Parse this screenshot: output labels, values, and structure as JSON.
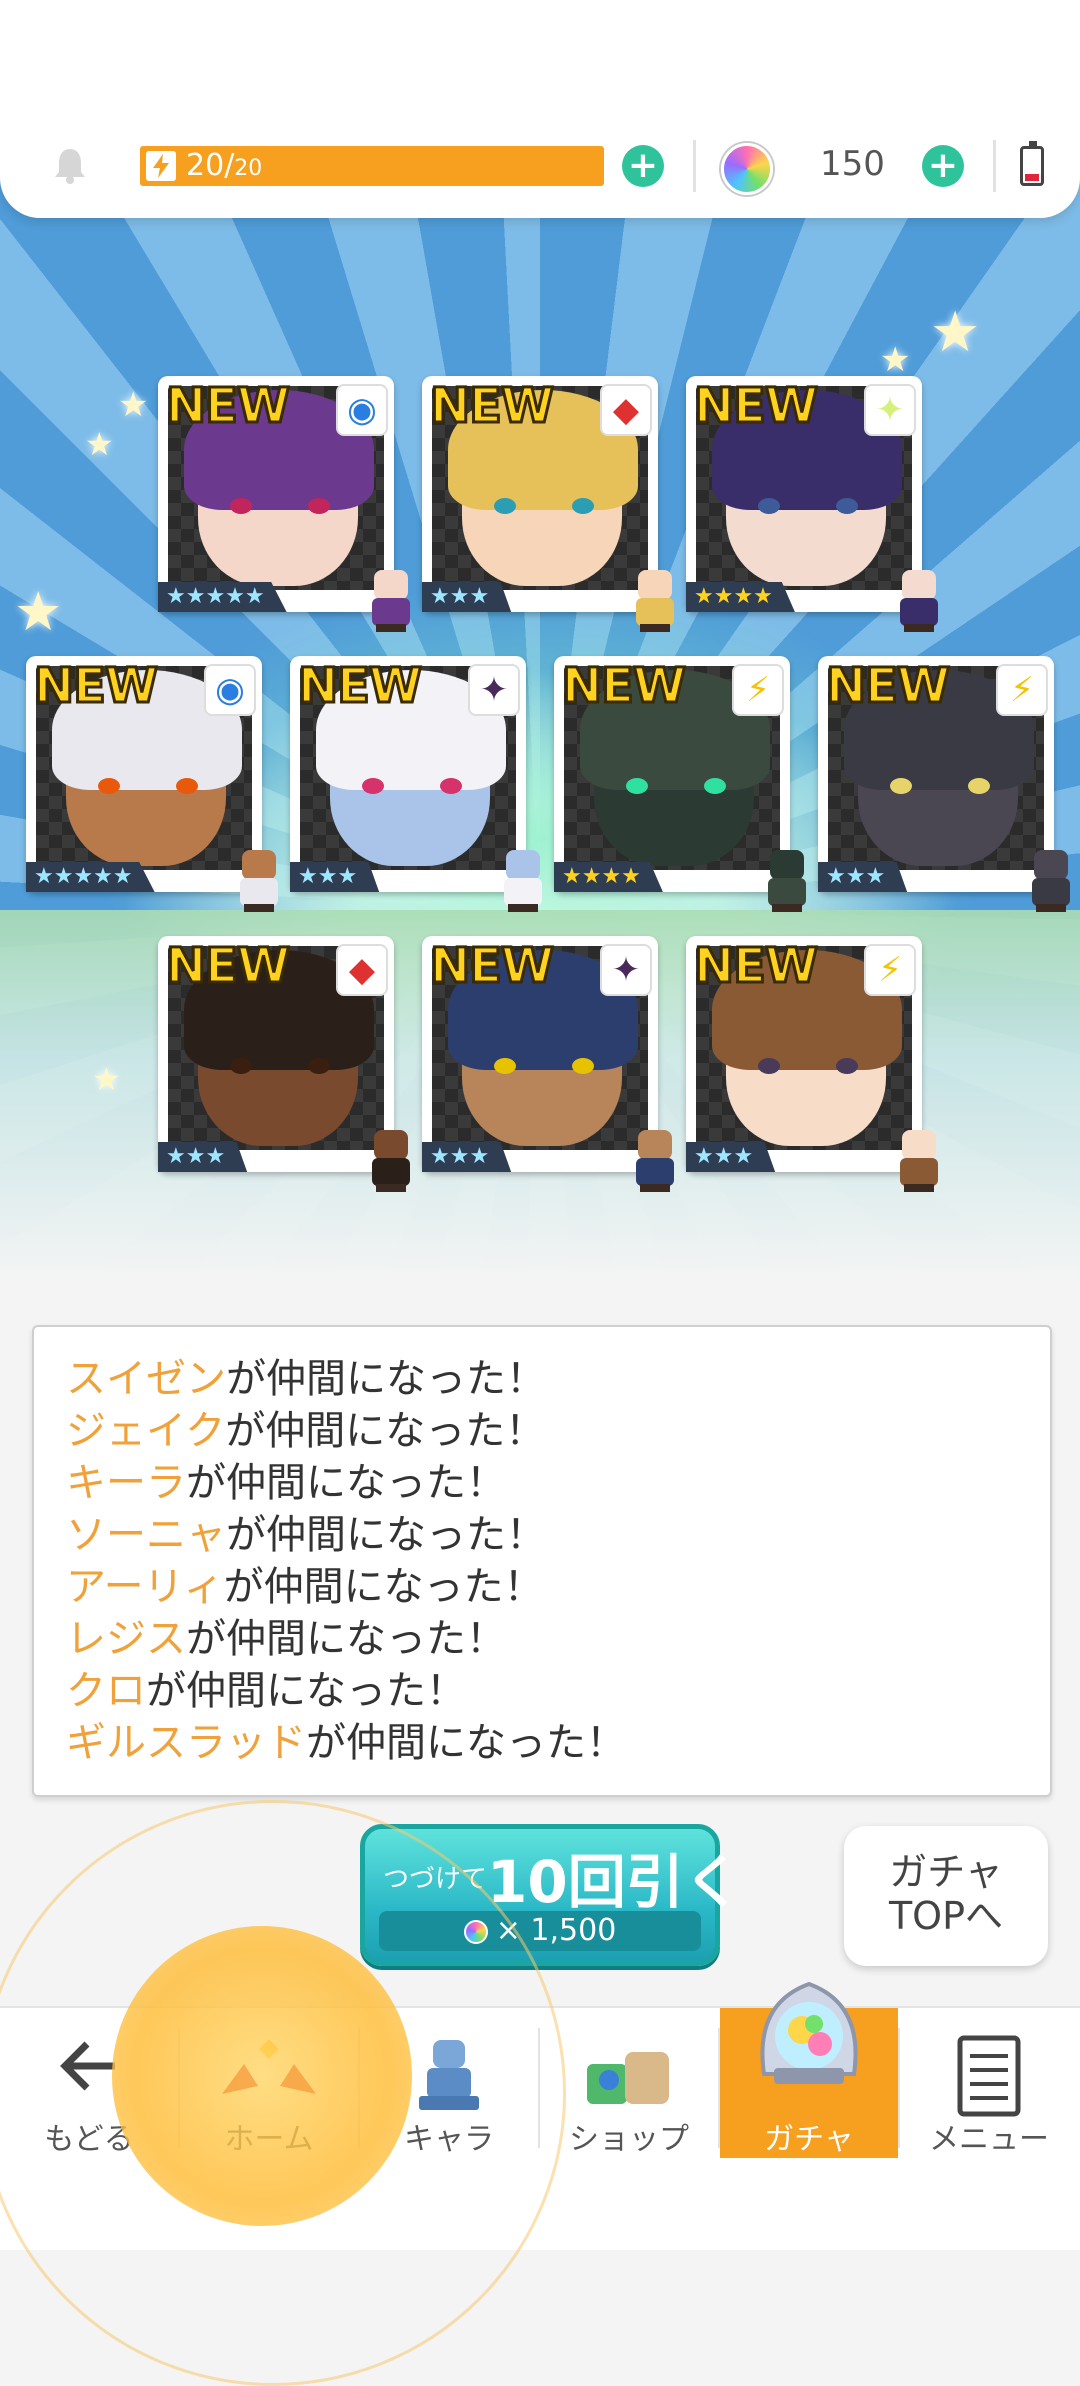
{
  "status_bar": {
    "stamina_current": "20",
    "stamina_separator": "/",
    "stamina_max": "20",
    "stamina_fraction": 1.0,
    "orb_count": "150",
    "stamina_color": "#f7a020",
    "add_color": "#2fc39c"
  },
  "result_cards": [
    {
      "new_label": "NEW",
      "element": "circle",
      "element_glyph": "◉",
      "element_color": "#2a7de1",
      "rarity": "★★★★★",
      "rarity_count": 5,
      "hair": "#6b3a8e",
      "skin": "#f4d7c8",
      "eye": "#c2255c"
    },
    {
      "new_label": "NEW",
      "element": "diamond",
      "element_glyph": "◆",
      "element_color": "#e03131",
      "rarity": "★★★",
      "rarity_count": 3,
      "hair": "#e6c15a",
      "skin": "#f6d5b8",
      "eye": "#2b9eb3"
    },
    {
      "new_label": "NEW",
      "element": "sparkle",
      "element_glyph": "✦",
      "element_color": "#d7f07a",
      "rarity": "★★★★",
      "rarity_count": 4,
      "hair": "#3a2e6a",
      "skin": "#f3dccf",
      "eye": "#3d5a99"
    },
    {
      "new_label": "NEW",
      "element": "circle",
      "element_glyph": "◉",
      "element_color": "#2a7de1",
      "rarity": "★★★★★",
      "rarity_count": 5,
      "hair": "#e8e8ee",
      "skin": "#b87a4b",
      "eye": "#e8590c"
    },
    {
      "new_label": "NEW",
      "element": "shuriken",
      "element_glyph": "✦",
      "element_color": "#4a2a5a",
      "rarity": "★★★",
      "rarity_count": 3,
      "hair": "#f2f2f7",
      "skin": "#a9c4e8",
      "eye": "#d6336c"
    },
    {
      "new_label": "NEW",
      "element": "lightning",
      "element_glyph": "⚡",
      "element_color": "#f5c400",
      "rarity": "★★★★",
      "rarity_count": 4,
      "hair": "#3b4a3f",
      "skin": "#2b3a33",
      "eye": "#2fe0a0"
    },
    {
      "new_label": "NEW",
      "element": "lightning",
      "element_glyph": "⚡",
      "element_color": "#f5c400",
      "rarity": "★★★",
      "rarity_count": 3,
      "hair": "#3a3a44",
      "skin": "#4a4752",
      "eye": "#e6d36a"
    },
    {
      "new_label": "NEW",
      "element": "diamond",
      "element_glyph": "◆",
      "element_color": "#e03131",
      "rarity": "★★★",
      "rarity_count": 3,
      "hair": "#2b1f1a",
      "skin": "#7a4a2e",
      "eye": "#3a1f10"
    },
    {
      "new_label": "NEW",
      "element": "shuriken",
      "element_glyph": "✦",
      "element_color": "#4a2a5a",
      "rarity": "★★★",
      "rarity_count": 3,
      "hair": "#2c3e6e",
      "skin": "#b8855a",
      "eye": "#e6c200"
    },
    {
      "new_label": "NEW",
      "element": "lightning",
      "element_glyph": "⚡",
      "element_color": "#f5c400",
      "rarity": "★★★",
      "rarity_count": 3,
      "hair": "#8a5a34",
      "skin": "#f7dcc8",
      "eye": "#4a3a5a"
    }
  ],
  "messages": [
    {
      "name": "スイゼン",
      "suffix": "が仲間になった！"
    },
    {
      "name": "ジェイク",
      "suffix": "が仲間になった！"
    },
    {
      "name": "キーラ",
      "suffix": "が仲間になった！"
    },
    {
      "name": "ソーニャ",
      "suffix": "が仲間になった！"
    },
    {
      "name": "アーリィ",
      "suffix": "が仲間になった！"
    },
    {
      "name": "レジス",
      "suffix": "が仲間になった！"
    },
    {
      "name": "クロ",
      "suffix": "が仲間になった！"
    },
    {
      "name": "ギルスラッド",
      "suffix": "が仲間になった！"
    }
  ],
  "pull_button": {
    "prefix": "つづけて",
    "label": "10回引く",
    "cost_prefix": "×",
    "cost": "1,500"
  },
  "gacha_top_button": {
    "line1": "ガチャ",
    "line2": "TOPへ"
  },
  "nav": {
    "back": "もどる",
    "home": "ホーム",
    "chara": "キャラ",
    "shop": "ショップ",
    "gacha": "ガチャ",
    "menu": "メニュー",
    "active": "gacha"
  }
}
